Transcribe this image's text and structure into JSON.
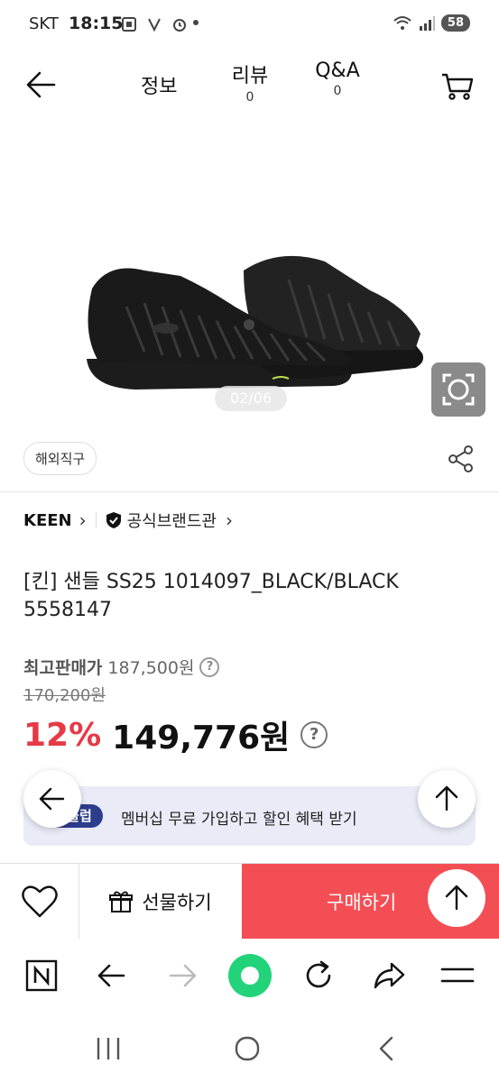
{
  "status": {
    "carrier": "SKT",
    "time": "18:15",
    "battery": "58"
  },
  "nav": {
    "tabs": [
      {
        "label": "정보",
        "count": ""
      },
      {
        "label": "리뷰",
        "count": "0"
      },
      {
        "label": "Q&A",
        "count": "0"
      }
    ]
  },
  "gallery": {
    "counter": "02/06"
  },
  "chip": "해외직구",
  "brand": {
    "name": "KEEN",
    "official_label": "공식브랜드관"
  },
  "product": {
    "title": "[킨] 샌들 SS25 1014097_BLACK/BLACK 5558147"
  },
  "price": {
    "best_label": "최고판매가",
    "best_value": "187,500원",
    "original": "170,200원",
    "discount": "12%",
    "final": "149,776원"
  },
  "promo": {
    "logo": "U클럽",
    "text": "멤버십 무료 가입하고 할인 혜택 받기"
  },
  "buybar": {
    "gift_label": "선물하기",
    "buy_label": "구매하기"
  },
  "colors": {
    "accent_red": "#f44e55",
    "discount_red": "#e63a46",
    "promo_bg": "#e9ecf7",
    "promo_logo_bg": "#2d3d8c",
    "browser_center": "#22d37a"
  }
}
